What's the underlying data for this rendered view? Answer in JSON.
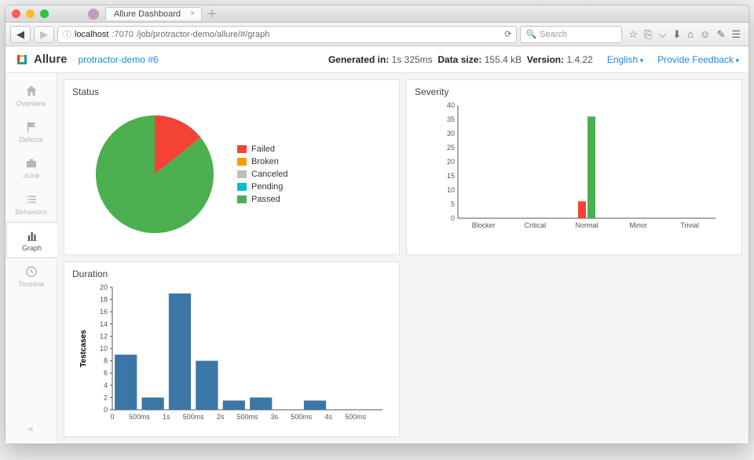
{
  "browser": {
    "tab_title": "Allure Dashboard",
    "url_host": "localhost",
    "url_port": ":7070",
    "url_path": "/job/protractor-demo/allure/#/graph",
    "search_placeholder": "Search"
  },
  "header": {
    "brand": "Allure",
    "breadcrumb": "protractor-demo #6",
    "generated_label": "Generated in:",
    "generated_value": "1s 325ms",
    "datasize_label": "Data size:",
    "datasize_value": "155.4 kB",
    "version_label": "Version:",
    "version_value": "1.4.22",
    "lang": "English",
    "feedback": "Provide Feedback"
  },
  "sidenav": {
    "items": [
      {
        "label": "Overview"
      },
      {
        "label": "Defects"
      },
      {
        "label": "xUnit"
      },
      {
        "label": "Behaviors"
      },
      {
        "label": "Graph"
      },
      {
        "label": "Timeline"
      }
    ]
  },
  "cards": {
    "status_title": "Status",
    "severity_title": "Severity",
    "duration_title": "Duration"
  },
  "colors": {
    "failed": "#f44336",
    "broken": "#ff9800",
    "canceled": "#bdbdbd",
    "pending": "#00bcd4",
    "passed": "#4caf50",
    "bar_blue": "#3c76a6"
  },
  "chart_data": [
    {
      "type": "pie",
      "id": "status",
      "title": "Status",
      "series": [
        {
          "name": "Failed",
          "value": 6,
          "color": "#f44336"
        },
        {
          "name": "Broken",
          "value": 0,
          "color": "#ff9800"
        },
        {
          "name": "Canceled",
          "value": 0,
          "color": "#bdbdbd"
        },
        {
          "name": "Pending",
          "value": 0,
          "color": "#00bcd4"
        },
        {
          "name": "Passed",
          "value": 36,
          "color": "#4caf50"
        }
      ],
      "legend_labels": [
        "Failed",
        "Broken",
        "Canceled",
        "Pending",
        "Passed"
      ]
    },
    {
      "type": "bar",
      "id": "severity",
      "title": "Severity",
      "categories": [
        "Blocker",
        "Critical",
        "Normal",
        "Minor",
        "Trivial"
      ],
      "series": [
        {
          "name": "Failed",
          "color": "#f44336",
          "values": [
            0,
            0,
            6,
            0,
            0
          ]
        },
        {
          "name": "Passed",
          "color": "#4caf50",
          "values": [
            0,
            0,
            36,
            0,
            0
          ]
        }
      ],
      "ylim": [
        0,
        40
      ],
      "yticks": [
        0,
        5,
        10,
        15,
        20,
        25,
        30,
        35,
        40
      ]
    },
    {
      "type": "bar",
      "id": "duration",
      "title": "Duration",
      "xlabel": "",
      "ylabel": "Testcases",
      "categories": [
        "0",
        "500ms",
        "1s",
        "500ms",
        "2s",
        "500ms",
        "3s",
        "500ms",
        "4s",
        "500ms"
      ],
      "values": [
        9,
        2,
        19,
        8,
        1.5,
        2,
        0,
        1.5,
        0,
        0
      ],
      "ylim": [
        0,
        20
      ],
      "yticks": [
        0,
        2,
        4,
        6,
        8,
        10,
        12,
        14,
        16,
        18,
        20
      ],
      "color": "#3c76a6"
    }
  ]
}
